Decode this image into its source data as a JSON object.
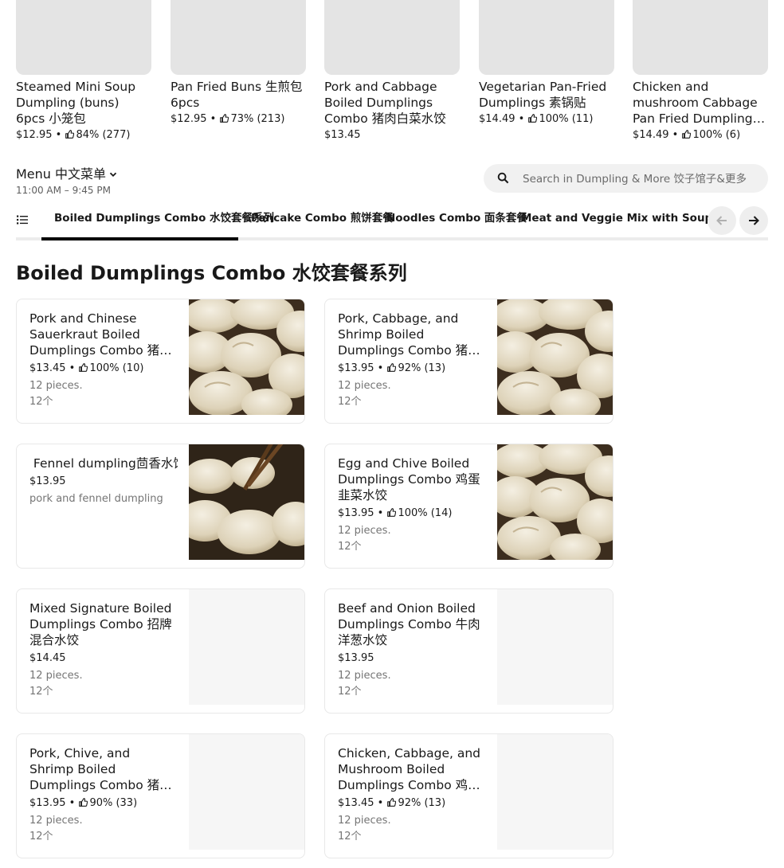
{
  "featured": [
    {
      "name": "Steamed Mini Soup Dumpling (buns) 6pcs 小笼包",
      "price": "$12.95",
      "rating": "84% (277)"
    },
    {
      "name": "Pan Fried Buns 生煎包 6pcs",
      "price": "$12.95",
      "rating": "73% (213)"
    },
    {
      "name": "Pork and Cabbage Boiled Dumplings Combo 猪肉白菜水饺",
      "price": "$13.45",
      "rating": ""
    },
    {
      "name": "Vegetarian  Pan-Fried Dumplings  素锅贴",
      "price": "$14.49",
      "rating": "100% (11)"
    },
    {
      "name": "Chicken and mushroom Cabbage Pan Fried Dumplings 鸡肉香菇白菜锅贴",
      "price": "$14.49",
      "rating": "100% (6)"
    }
  ],
  "menu": {
    "title": "Menu 中文菜单",
    "hours": "11:00 AM – 9:45 PM"
  },
  "search": {
    "placeholder": "Search in Dumpling & More 饺子馆子&更多"
  },
  "tabs": [
    {
      "label": "Boiled Dumplings Combo 水饺套餐系列"
    },
    {
      "label": "Pancake Combo 煎饼套餐"
    },
    {
      "label": "Noodles Combo 面条套餐"
    },
    {
      "label": "Meat and Veggie Mix with Soup Combo"
    }
  ],
  "section": {
    "title": "Boiled Dumplings Combo 水饺套餐系列"
  },
  "items": [
    {
      "name": "Pork and Chinese Sauerkraut Boiled Dumplings Combo 猪肉酸菜水饺",
      "price": "$13.45",
      "rating": "100% (10)",
      "desc": "12 pieces.",
      "desc2": "12个",
      "image": "dumplings"
    },
    {
      "name": "Pork, Cabbage, and Shrimp Boiled Dumplings Combo 猪肉白菜虾仁水饺",
      "price": "$13.95",
      "rating": "92% (13)",
      "desc": "12 pieces.",
      "desc2": "12个",
      "image": "dumplings"
    },
    {
      "name": " Fennel dumpling茴香水饺",
      "price": "$13.95",
      "rating": "",
      "desc": "pork and fennel dumpling",
      "desc2": "",
      "image": "chopsticks"
    },
    {
      "name": "Egg and Chive Boiled Dumplings Combo 鸡蛋韭菜水饺",
      "price": "$13.95",
      "rating": "100% (14)",
      "desc": "12 pieces.",
      "desc2": "12个",
      "image": "dumplings"
    },
    {
      "name": "Mixed Signature Boiled Dumplings Combo 招牌混合水饺",
      "price": "$14.45",
      "rating": "",
      "desc": "12 pieces.",
      "desc2": "12个",
      "image": ""
    },
    {
      "name": "Beef and Onion Boiled Dumplings Combo 牛肉洋葱水饺",
      "price": "$13.95",
      "rating": "",
      "desc": "12 pieces.",
      "desc2": "12个",
      "image": ""
    },
    {
      "name": "Pork, Chive, and Shrimp Boiled Dumplings Combo 猪肉韭菜虾仁水饺",
      "price": "$13.95",
      "rating": "90% (33)",
      "desc": "12 pieces.",
      "desc2": "12个",
      "image": ""
    },
    {
      "name": "Chicken, Cabbage, and Mushroom Boiled Dumplings Combo 鸡肉白菜香菇水饺",
      "price": "$13.45",
      "rating": "92% (13)",
      "desc": "12 pieces.",
      "desc2": "12个",
      "image": ""
    }
  ],
  "icons": {
    "thumb": "thumbs-up-icon",
    "search": "search-icon",
    "list": "list-icon",
    "chevron": "chevron-down-icon",
    "prev": "arrow-left-icon",
    "next": "arrow-right-icon"
  },
  "colors": {
    "text": "#191919",
    "muted": "#757575",
    "placeholder_bg": "#e4e4e4",
    "search_bg": "#f1f1f1",
    "active_tab": "#000000"
  }
}
